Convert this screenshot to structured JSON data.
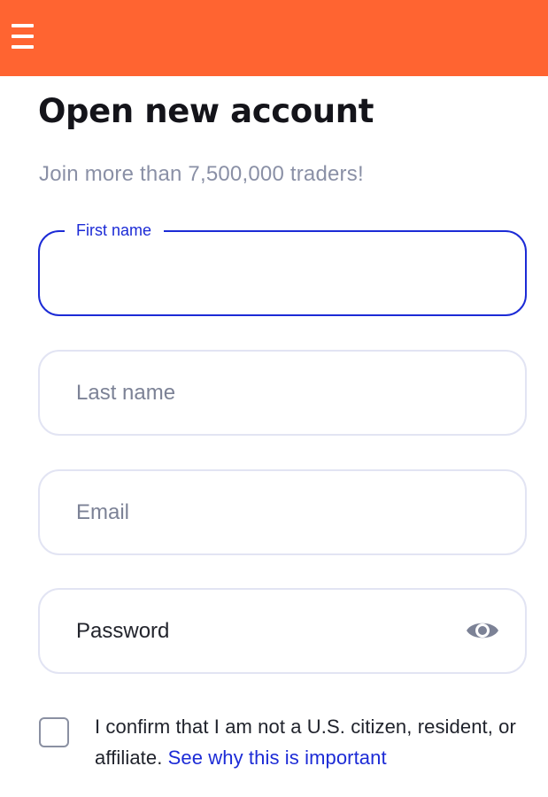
{
  "header": {
    "menu_icon": "hamburger-menu-icon",
    "background_color": "#ff6431"
  },
  "page": {
    "title": "Open new account",
    "subtitle": "Join more than 7,500,000 traders!"
  },
  "form": {
    "first_name": {
      "label": "First name",
      "value": ""
    },
    "last_name": {
      "placeholder": "Last name",
      "value": ""
    },
    "email": {
      "placeholder": "Email",
      "value": ""
    },
    "password": {
      "placeholder": "Password",
      "value": "",
      "toggle_icon": "eye-icon"
    }
  },
  "consent": {
    "checked": false,
    "text": "I confirm that I am not a U.S. citizen, resident, or affiliate.",
    "link_text": "See why this is important"
  },
  "colors": {
    "accent": "#1c2bd6",
    "field_border": "#e2e4f3",
    "muted_text": "#8a90a6"
  }
}
